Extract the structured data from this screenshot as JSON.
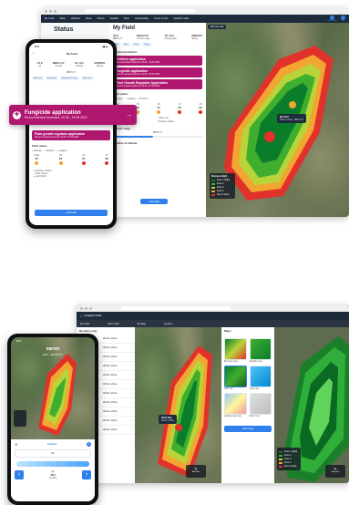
{
  "top_window": {
    "nav_brand": "My Field",
    "nav_items": [
      "Tasks",
      "Weather",
      "Notes",
      "Photos",
      "Satellite",
      "Shop",
      "Sustainability",
      "Smart scouts",
      "Satellite Fields"
    ],
    "nav_right": [
      "Notifications",
      "Me"
    ],
    "status_panel": {
      "title": "Status",
      "field_title": "My Field",
      "stats": [
        {
          "value": "44,6",
          "label": "BBCH 37"
        },
        {
          "value": "BBCH 37",
          "label": "Growth stage"
        },
        {
          "value": "16. Oct",
          "label": "Sowing date"
        },
        {
          "value": "ADE55O",
          "label": "Variety"
        }
      ],
      "recommendations_header": "Recommendations",
      "recommendations": [
        {
          "title": "Fertilizer application",
          "subtitle": "Recommended treatment: 16.03 - 16.04.2022",
          "color": "#b0176f"
        },
        {
          "title": "Fungicide application",
          "subtitle": "Recommended treatment: 20.05 - 29.05.2022",
          "color": "#b0176f"
        },
        {
          "title": "Plant Growth Regulator Application",
          "subtitle": "Recommended treatment: 29.05 - 07.06.2022",
          "color": "#b0176f"
        }
      ],
      "field_status_header": "Field status",
      "status_tabs": [
        "Disease",
        "Lodging",
        "Nutrition"
      ],
      "days": [
        {
          "label": "Today",
          "value": "25"
        },
        {
          "label": "25",
          "value": "26"
        },
        {
          "label": "26",
          "value": "27"
        },
        {
          "label": "27",
          "value": "28"
        },
        {
          "label": "28",
          "value": "29"
        }
      ],
      "legend": [
        "Septoria",
        "Yellow rust",
        "Brown rust",
        "Powdery mildew"
      ],
      "growth_stage_header": "Growth stage",
      "growth_stage_value": "BBCH 37",
      "weather_header": "Weather & Climate",
      "add_task": "Add task"
    },
    "map": {
      "toolbar_left": "Biomass map",
      "field_label": "My Field",
      "field_label_sub": "Winter wheat · BBCH 37",
      "legend_title": "Biomass (high)",
      "legend_items": [
        "Zone 1 (high)",
        "Zone 2",
        "Zone 3",
        "Zone 4",
        "Zone 5 (low)"
      ],
      "legend_colors": [
        "#0a7d2b",
        "#3fae2f",
        "#b9d43a",
        "#f2a531",
        "#e0322a"
      ]
    }
  },
  "top_phone": {
    "time": "9:41",
    "title": "My Field",
    "stats": [
      "44,6",
      "BBCH 37",
      "16. Oct",
      "ADE55O"
    ],
    "stat_labels": [
      "ha",
      "Growth",
      "Sowing",
      "Variety"
    ],
    "stage_line": "BBCH 37",
    "chips": [
      "Add note",
      "Add photo",
      "Add growth stage",
      "Add notes"
    ],
    "rec_title": "Plant growth regulator application",
    "rec_subtitle": "Recommended treatment: 29.05 - 07.06.2022",
    "field_status": "Field status",
    "tabs": [
      "Disease",
      "Nutrition",
      "Lodging"
    ],
    "days": [
      {
        "label": "Today",
        "value": "25"
      },
      {
        "label": "25",
        "value": "26"
      },
      {
        "label": "26",
        "value": "27"
      },
      {
        "label": "27",
        "value": "28"
      }
    ],
    "legend": [
      "Powdery mildew",
      "Rust (other)",
      "Leaf blotch"
    ],
    "add_task": "Add task"
  },
  "callout": {
    "title": "Fungicide application",
    "subtitle": "Recommended treatment: 20.05 - 29.05.2022",
    "arrow": "→"
  },
  "bottom_window": {
    "mode_title": "Compare mode",
    "left_header": "Biomass map",
    "field_names": [
      "My Field",
      "Other Field",
      "My Map",
      "Anytime"
    ],
    "list_rows": [
      {
        "name": "Winter wheat",
        "tag": "Winter wheat"
      },
      {
        "name": "Winter wheat",
        "tag": "Winter wheat"
      },
      {
        "name": "Winter wheat",
        "tag": "Winter wheat"
      },
      {
        "name": "Winter wheat",
        "tag": "Winter wheat"
      },
      {
        "name": "Winter wheat",
        "tag": "Winter wheat"
      },
      {
        "name": "Winter wheat",
        "tag": "Winter wheat"
      },
      {
        "name": "Winter wheat",
        "tag": "Winter wheat"
      },
      {
        "name": "Winter wheat",
        "tag": "Winter wheat"
      },
      {
        "name": "Winter wheat",
        "tag": "Winter wheat"
      },
      {
        "name": "Winter wheat",
        "tag": "Winter wheat"
      },
      {
        "name": "Winter wheat",
        "tag": "Winter wheat"
      }
    ],
    "popup_title": "Drain Map",
    "popup_sub": "Winter wheat",
    "maps_header": "Maps",
    "map_tiles": [
      "Biomass map",
      "Satellite map",
      "Soil map",
      "Yield map",
      "Variable rate map",
      "Drain map"
    ],
    "add_map": "Add map",
    "tool_labels": [
      "Add note",
      "Add note"
    ],
    "legend_items": [
      "Zone 1 (high)",
      "Zone 2",
      "Zone 3",
      "Zone 4",
      "Zone 5 (low)"
    ],
    "legend_colors": [
      "#0a7d2b",
      "#3fae2f",
      "#b9d43a",
      "#f2a531",
      "#e0322a"
    ]
  },
  "bottom_phone": {
    "time": "9:41",
    "brand": "xarvio",
    "subtitle": "DAY · ACTIVITY",
    "compare": "Compare",
    "min_label": "Min",
    "qty": "40,5",
    "unit": "kg N/ha",
    "value_label": "Qty",
    "nav_prev": "‹",
    "nav_next": "›"
  }
}
